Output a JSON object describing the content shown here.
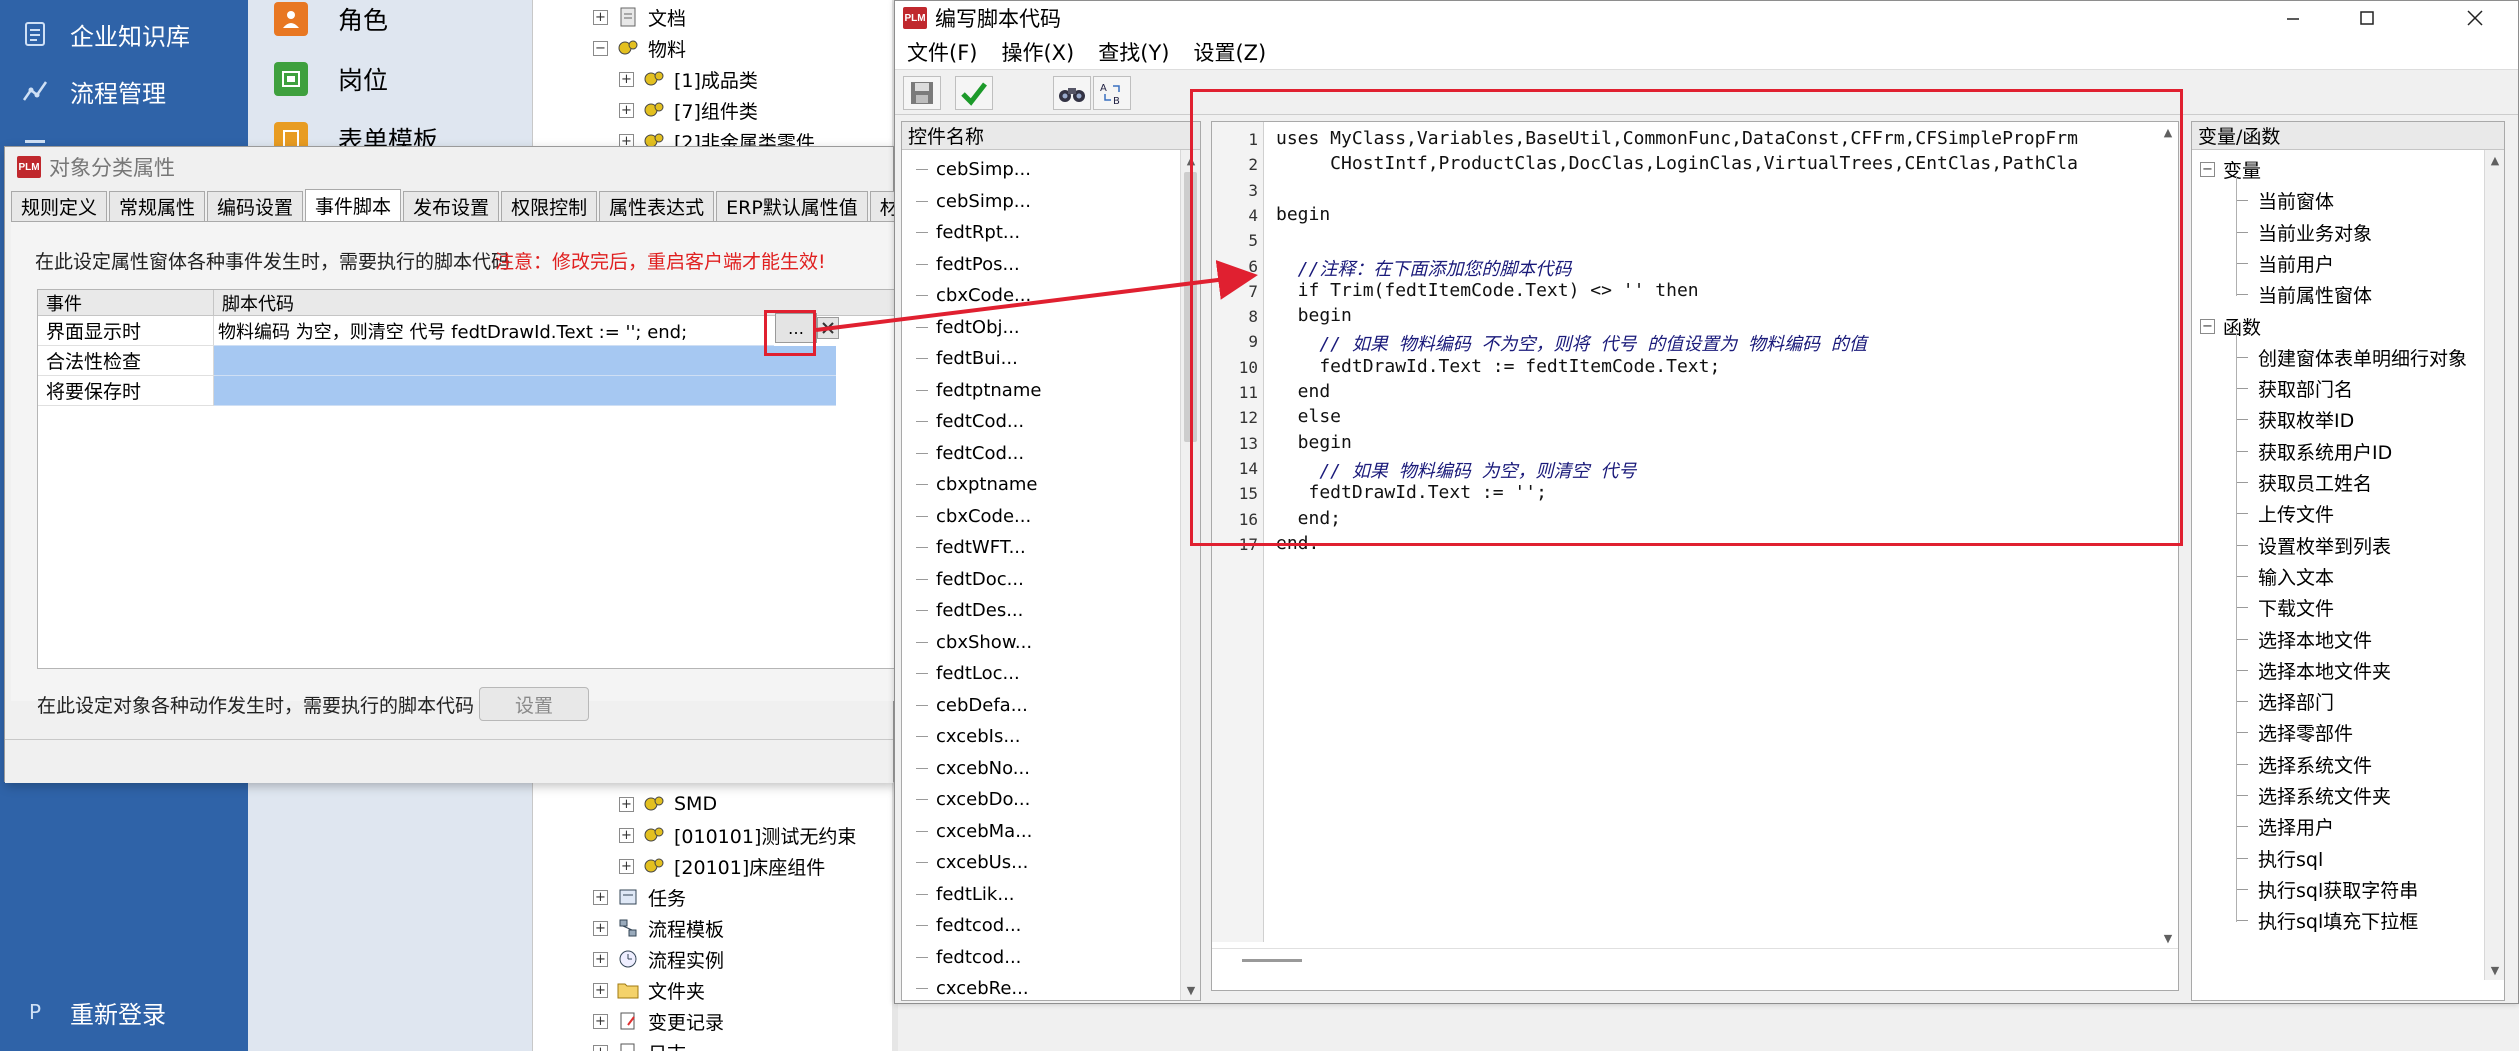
{
  "left_nav": {
    "items": [
      {
        "label": "企业知识库",
        "icon": "document-list-icon"
      },
      {
        "label": "流程管理",
        "icon": "flow-chart-icon"
      },
      {
        "label": "重新登录",
        "icon": "letter-p-icon"
      }
    ]
  },
  "col2": {
    "items": [
      {
        "label": "角色",
        "icon": "role-icon",
        "color": "#e87722"
      },
      {
        "label": "岗位",
        "icon": "post-icon",
        "color": "#3ea03e"
      },
      {
        "label": "表单模板",
        "icon": "form-template-icon",
        "color": "#e89c22"
      }
    ]
  },
  "tree": {
    "top": [
      {
        "label": "文档",
        "indent": 0
      },
      {
        "label": "物料",
        "indent": 0
      },
      {
        "label": "[1]成品类",
        "indent": 1
      },
      {
        "label": "[7]组件类",
        "indent": 1
      },
      {
        "label": "[2]非金属类零件",
        "indent": 1
      }
    ],
    "bottom": [
      {
        "label": "SMD",
        "indent": 1
      },
      {
        "label": "[010101]测试无约束",
        "indent": 1
      },
      {
        "label": "[20101]床座组件",
        "indent": 1
      },
      {
        "label": "任务",
        "indent": 0
      },
      {
        "label": "流程模板",
        "indent": 0
      },
      {
        "label": "流程实例",
        "indent": 0
      },
      {
        "label": "文件夹",
        "indent": 0
      },
      {
        "label": "变更记录",
        "indent": 0
      },
      {
        "label": "日志",
        "indent": 0
      }
    ]
  },
  "dialog": {
    "app_badge": "PLM",
    "title": "对象分类属性",
    "tabs": [
      "规则定义",
      "常规属性",
      "编码设置",
      "事件脚本",
      "发布设置",
      "权限控制",
      "属性表达式",
      "ERP默认属性值",
      "材料"
    ],
    "active_tab": "事件脚本",
    "description": "在此设定属性窗体各种事件发生时，需要执行的脚本代码",
    "warning": "注意：修改完后，重启客户端才能生效!",
    "table_headers": {
      "event": "事件",
      "script": "脚本代码"
    },
    "events": [
      {
        "name": "界面显示时",
        "code": "物料编码 为空，则清空 代号    fedtDrawId.Text := '';  end;"
      },
      {
        "name": "合法性检查",
        "code": ""
      },
      {
        "name": "将要保存时",
        "code": ""
      }
    ],
    "ellipsis": "…",
    "description2": "在此设定对象各种动作发生时，需要执行的脚本代码",
    "set_button": "设置"
  },
  "window": {
    "app_badge": "PLM",
    "title": "编写脚本代码",
    "menus": [
      "文件(F)",
      "操作(X)",
      "查找(Y)",
      "设置(Z)"
    ],
    "controls_header": "控件名称",
    "controls": [
      "cebSimp...",
      "cebSimp...",
      "fedtRpt...",
      "fedtPos...",
      "cbxCode...",
      "fedtObj...",
      "fedtBui...",
      "fedtptname",
      "fedtCod...",
      "fedtCod...",
      "cbxptname",
      "cbxCode...",
      "fedtWFT...",
      "fedtDoc...",
      "fedtDes...",
      "cbxShow...",
      "fedtLoc...",
      "cebDefa...",
      "cxcebIs...",
      "cxcebNo...",
      "cxcebDo...",
      "cxcebMa...",
      "cxcebUs...",
      "fedtLik...",
      "fedtcod...",
      "fedtcod...",
      "cxcebRe..."
    ],
    "code_lines": [
      "uses MyClass,Variables,BaseUtil,CommonFunc,DataConst,CFFrm,CFSimplePropFrm",
      "     CHostIntf,ProductClas,DocClas,LoginClas,VirtualTrees,CEntClas,PathCla",
      "",
      "begin",
      "",
      "  //注释：在下面添加您的脚本代码",
      "  if Trim(fedtItemCode.Text) <> '' then",
      "  begin",
      "    // 如果 物料编码 不为空，则将 代号 的值设置为 物料编码 的值",
      "    fedtDrawId.Text := fedtItemCode.Text;",
      "  end",
      "  else",
      "  begin",
      "    // 如果 物料编码 为空，则清空 代号",
      "   fedtDrawId.Text := '';",
      "  end;",
      "end."
    ],
    "vars_header": "变量/函数",
    "var_groups": [
      {
        "label": "变量",
        "items": [
          "当前窗体",
          "当前业务对象",
          "当前用户",
          "当前属性窗体"
        ]
      },
      {
        "label": "函数",
        "items": [
          "创建窗体表单明细行对象",
          "获取部门名",
          "获取枚举ID",
          "获取系统用户ID",
          "获取员工姓名",
          "上传文件",
          "设置枚举到列表",
          "输入文本",
          "下载文件",
          "选择本地文件",
          "选择本地文件夹",
          "选择部门",
          "选择零部件",
          "选择系统文件",
          "选择系统文件夹",
          "选择用户",
          "执行sql",
          "执行sql获取字符串",
          "执行sql填充下拉框"
        ]
      }
    ]
  },
  "colors": {
    "annotation": "#e02030",
    "nav_bg": "#2f63a8",
    "selection": "#a6c8f2"
  }
}
